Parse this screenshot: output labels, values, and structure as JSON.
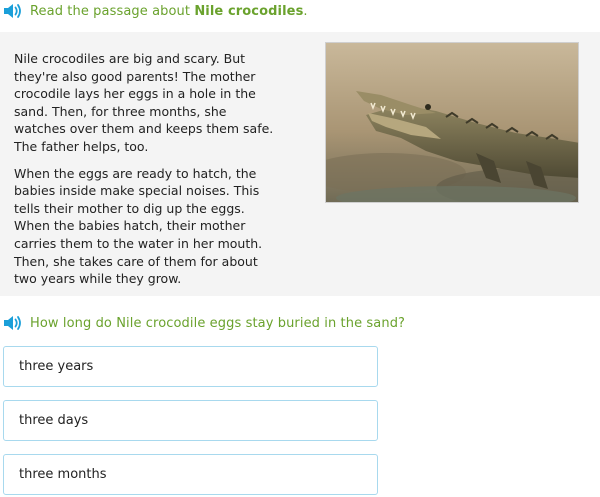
{
  "header": {
    "prompt_prefix": "Read the passage about ",
    "prompt_bold": "Nile crocodiles",
    "prompt_suffix": ".",
    "icon": "speaker-icon"
  },
  "passage": {
    "paragraphs": [
      "Nile crocodiles are big and scary. But they're also good parents! The mother crocodile lays her eggs in a hole in the sand. Then, for three months, she watches over them and keeps them safe. The father helps, too.",
      "When the eggs are ready to hatch, the babies inside make special noises. This tells their mother to dig up the eggs. When the babies hatch, their mother carries them to the water in her mouth. Then, she takes care of them for about two years while they grow."
    ],
    "image": "nile-crocodile-photo"
  },
  "question": {
    "text": "How long do Nile crocodile eggs stay buried in the sand?",
    "icon": "speaker-icon"
  },
  "choices": [
    {
      "label": "three years"
    },
    {
      "label": "three days"
    },
    {
      "label": "three months"
    }
  ],
  "colors": {
    "prompt_green": "#6aa22d",
    "speaker_blue": "#1a9fd9",
    "choice_border": "#a8d9ee",
    "panel_bg": "#f4f4f4"
  }
}
